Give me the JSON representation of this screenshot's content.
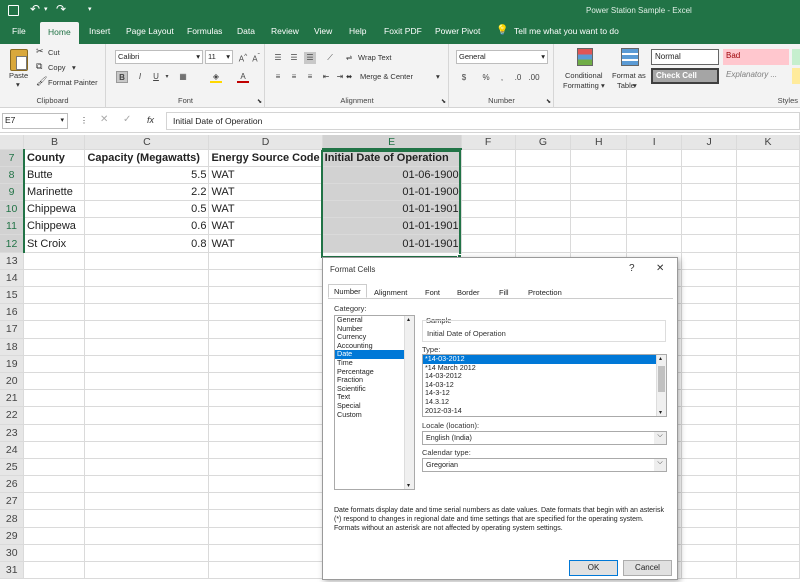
{
  "app": {
    "title": "Power Station Sample  -  Excel"
  },
  "tabs": [
    "File",
    "Home",
    "Insert",
    "Page Layout",
    "Formulas",
    "Data",
    "Review",
    "View",
    "Help",
    "Foxit PDF",
    "Power Pivot"
  ],
  "tell_me": "Tell me what you want to do",
  "ribbon": {
    "clipboard": {
      "label": "Clipboard",
      "paste": "Paste",
      "cut": "Cut",
      "copy": "Copy",
      "format_painter": "Format Painter"
    },
    "font": {
      "label": "Font",
      "name": "Calibri",
      "size": "11",
      "bold": "B",
      "italic": "I",
      "underline": "U"
    },
    "alignment": {
      "label": "Alignment",
      "wrap": "Wrap Text",
      "merge": "Merge & Center"
    },
    "number": {
      "label": "Number",
      "format": "General"
    },
    "styles": {
      "label": "Styles",
      "conditional": "Conditional",
      "formatting": "Formatting",
      "format_as": "Format as",
      "table": "Table",
      "normal": "Normal",
      "bad": "Bad",
      "check_cell": "Check Cell",
      "explanatory": "Explanatory ..."
    }
  },
  "formula_bar": {
    "name_box": "E7",
    "fx": "fx",
    "content": "Initial Date of Operation"
  },
  "sheet": {
    "columns": [
      "B",
      "C",
      "D",
      "E",
      "F",
      "G",
      "H",
      "I",
      "J",
      "K"
    ],
    "rows": [
      {
        "n": "7",
        "cells": [
          "County",
          "Capacity (Megawatts)",
          "Energy Source Code",
          "Initial Date of Operation"
        ]
      },
      {
        "n": "8",
        "cells": [
          "Butte",
          "5.5",
          "WAT",
          "01-06-1900"
        ]
      },
      {
        "n": "9",
        "cells": [
          "Marinette",
          "2.2",
          "WAT",
          "01-01-1900"
        ]
      },
      {
        "n": "10",
        "cells": [
          "Chippewa",
          "0.5",
          "WAT",
          "01-01-1901"
        ]
      },
      {
        "n": "11",
        "cells": [
          "Chippewa",
          "0.6",
          "WAT",
          "01-01-1901"
        ]
      },
      {
        "n": "12",
        "cells": [
          "St Croix",
          "0.8",
          "WAT",
          "01-01-1901"
        ]
      }
    ],
    "empty_rows": [
      "13",
      "14",
      "15",
      "16",
      "17",
      "18",
      "19",
      "20",
      "21",
      "22",
      "23",
      "24",
      "25",
      "26",
      "27",
      "28",
      "29",
      "30",
      "31"
    ]
  },
  "dialog": {
    "title": "Format Cells",
    "help": "?",
    "close": "✕",
    "tabs": [
      "Number",
      "Alignment",
      "Font",
      "Border",
      "Fill",
      "Protection"
    ],
    "category_label": "Category:",
    "categories": [
      "General",
      "Number",
      "Currency",
      "Accounting",
      "Date",
      "Time",
      "Percentage",
      "Fraction",
      "Scientific",
      "Text",
      "Special",
      "Custom"
    ],
    "selected_category": "Date",
    "sample_label": "Sample",
    "sample_value": "Initial Date of Operation",
    "type_label": "Type:",
    "types": [
      "*14-03-2012",
      "*14 March 2012",
      "14-03-2012",
      "14-03-12",
      "14-3-12",
      "14.3.12",
      "2012-03-14"
    ],
    "selected_type": "*14-03-2012",
    "locale_label": "Locale (location):",
    "locale_value": "English (India)",
    "calendar_label": "Calendar type:",
    "calendar_value": "Gregorian",
    "description": "Date formats display date and time serial numbers as date values.  Date formats that begin with an asterisk (*) respond to changes in regional date and time settings that are specified for the operating system. Formats without an asterisk are not affected by operating system settings.",
    "ok": "OK",
    "cancel": "Cancel"
  },
  "colors": {
    "excel_green": "#217346",
    "selection_blue": "#0078d7"
  }
}
